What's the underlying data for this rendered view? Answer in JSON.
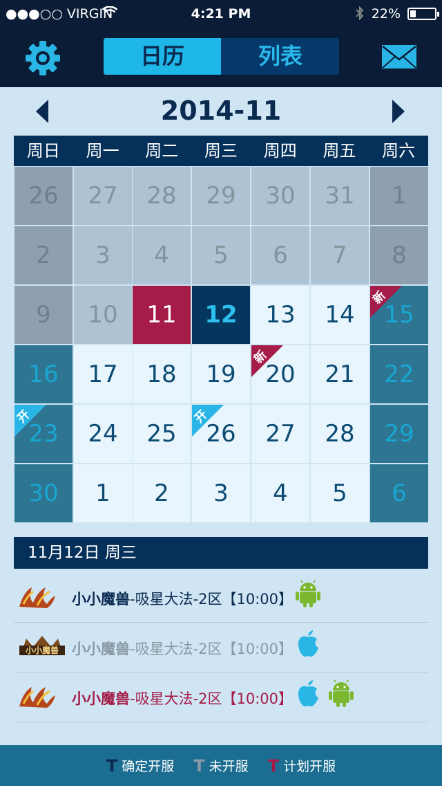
{
  "status": {
    "carrier": "●●●○○ VIRGIN",
    "time": "4:21 PM",
    "battery": "22%",
    "battery_level": 0.22
  },
  "nav": {
    "tab_calendar": "日历",
    "tab_list": "列表"
  },
  "month": "2014-11",
  "weekdays": [
    "周日",
    "周一",
    "周二",
    "周三",
    "周四",
    "周五",
    "周六"
  ],
  "days": [
    [
      {
        "n": "26",
        "s": "grey"
      },
      {
        "n": "27",
        "s": "pale"
      },
      {
        "n": "28",
        "s": "pale"
      },
      {
        "n": "29",
        "s": "pale"
      },
      {
        "n": "30",
        "s": "pale"
      },
      {
        "n": "31",
        "s": "pale"
      },
      {
        "n": "1",
        "s": "grey"
      }
    ],
    [
      {
        "n": "2",
        "s": "grey"
      },
      {
        "n": "3",
        "s": "pale"
      },
      {
        "n": "4",
        "s": "pale"
      },
      {
        "n": "5",
        "s": "pale"
      },
      {
        "n": "6",
        "s": "pale"
      },
      {
        "n": "7",
        "s": "pale"
      },
      {
        "n": "8",
        "s": "grey"
      }
    ],
    [
      {
        "n": "9",
        "s": "grey"
      },
      {
        "n": "10",
        "s": "pale"
      },
      {
        "n": "11",
        "s": "red"
      },
      {
        "n": "12",
        "s": "sel"
      },
      {
        "n": "13",
        "s": "white"
      },
      {
        "n": "14",
        "s": "white"
      },
      {
        "n": "15",
        "s": "teal",
        "tag": "新",
        "tagColor": "#a41c47"
      }
    ],
    [
      {
        "n": "16",
        "s": "teal"
      },
      {
        "n": "17",
        "s": "white"
      },
      {
        "n": "18",
        "s": "white"
      },
      {
        "n": "19",
        "s": "white"
      },
      {
        "n": "20",
        "s": "white",
        "tag": "新",
        "tagColor": "#a41c47"
      },
      {
        "n": "21",
        "s": "white"
      },
      {
        "n": "22",
        "s": "teal"
      }
    ],
    [
      {
        "n": "23",
        "s": "teal",
        "tag": "开",
        "tagColor": "#29b6e6"
      },
      {
        "n": "24",
        "s": "white"
      },
      {
        "n": "25",
        "s": "white"
      },
      {
        "n": "26",
        "s": "white",
        "tag": "开",
        "tagColor": "#29b6e6"
      },
      {
        "n": "27",
        "s": "white"
      },
      {
        "n": "28",
        "s": "white"
      },
      {
        "n": "29",
        "s": "teal"
      }
    ],
    [
      {
        "n": "30",
        "s": "teal"
      },
      {
        "n": "1",
        "s": "white"
      },
      {
        "n": "2",
        "s": "white"
      },
      {
        "n": "3",
        "s": "white"
      },
      {
        "n": "4",
        "s": "white"
      },
      {
        "n": "5",
        "s": "white"
      },
      {
        "n": "6",
        "s": "teal"
      }
    ]
  ],
  "selected_date_label": "11月12日 周三",
  "events": [
    {
      "name": "小小魔兽",
      "suffix": "-吸星大法-2区【10:00】",
      "color": "#0a2a50",
      "name_color": "#0a2a50",
      "logo": "swordsman-logo",
      "platforms": [
        "android"
      ]
    },
    {
      "name": "小小魔兽",
      "suffix": "-吸星大法-2区【10:00】",
      "color": "#8a99a6",
      "name_color": "#8a99a6",
      "logo": "warcraft-logo",
      "platforms": [
        "ios"
      ]
    },
    {
      "name": "小小魔兽",
      "suffix": "-吸星大法-2区【10:00】",
      "color": "#a41c47",
      "name_color": "#a41c47",
      "logo": "swordsman-logo",
      "platforms": [
        "ios",
        "android"
      ]
    }
  ],
  "legend": [
    {
      "label": "确定开服",
      "color": "#0a2a50"
    },
    {
      "label": "未开服",
      "color": "#8a99a6"
    },
    {
      "label": "计划开服",
      "color": "#a41c47"
    }
  ]
}
